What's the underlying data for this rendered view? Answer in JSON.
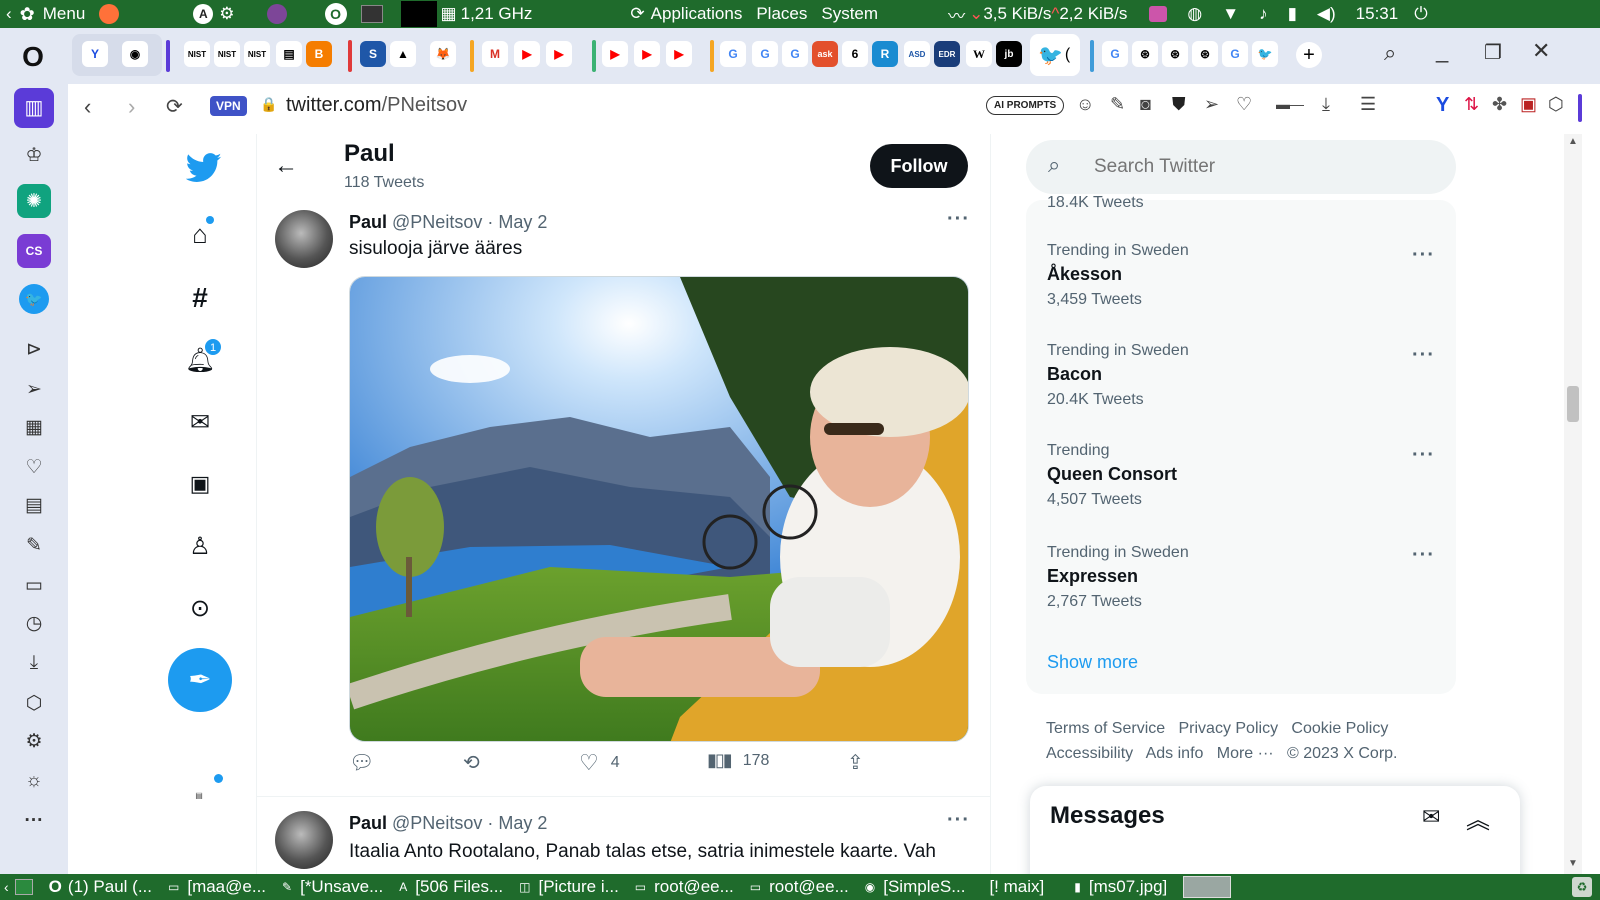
{
  "panel": {
    "menu_label": "Menu",
    "cpu_freq": "1,21 GHz",
    "apps": "Applications",
    "places": "Places",
    "system": "System",
    "down_speed": "3,5 KiB/s",
    "up_speed": "2,2 KiB/s",
    "clock": "15:31"
  },
  "browser": {
    "vpn_badge": "VPN",
    "url_host": "twitter.com",
    "url_path": "/PNeitsov",
    "ai_prompts": "AI PROMPTS"
  },
  "profile_header": {
    "name": "Paul",
    "tweet_count": "118 Tweets",
    "follow_label": "Follow"
  },
  "tweet1": {
    "display_name": "Paul",
    "handle": "@PNeitsov",
    "sep": "·",
    "date": "May 2",
    "text": "sisulooja järve ääres",
    "likes": "4",
    "views": "178"
  },
  "tweet2": {
    "display_name": "Paul",
    "handle": "@PNeitsov",
    "sep": "·",
    "date": "May 2",
    "text": "Itaalia Anto Rootalano, Panab talas etse, satria inimestele kaarte. Vah"
  },
  "notifications_badge": "1",
  "search": {
    "placeholder": "Search Twitter"
  },
  "trends_partial": "18.4K Tweets",
  "trends": [
    {
      "context": "Trending in Sweden",
      "name": "Åkesson",
      "count": "3,459 Tweets"
    },
    {
      "context": "Trending in Sweden",
      "name": "Bacon",
      "count": "20.4K Tweets"
    },
    {
      "context": "Trending",
      "name": "Queen Consort",
      "count": "4,507 Tweets"
    },
    {
      "context": "Trending in Sweden",
      "name": "Expressen",
      "count": "2,767 Tweets"
    }
  ],
  "show_more": "Show more",
  "footer_links": {
    "terms": "Terms of Service",
    "privacy": "Privacy Policy",
    "cookie": "Cookie Policy",
    "accessibility": "Accessibility",
    "ads": "Ads info",
    "more": "More ···",
    "copyright": "© 2023 X Corp."
  },
  "messages": {
    "title": "Messages"
  },
  "taskbar": {
    "items": [
      "(1) Paul (...",
      "[maa@e...",
      "[*Unsave...",
      "[506 Files...",
      "[Picture i...",
      "root@ee...",
      "root@ee...",
      "[SimpleS...",
      "[! maix]",
      "[ms07.jpg]"
    ]
  },
  "colors": {
    "twitter_blue": "#1d9bf0",
    "panel_green": "#1f6b2c",
    "text_primary": "#0f1419",
    "text_secondary": "#536471"
  }
}
